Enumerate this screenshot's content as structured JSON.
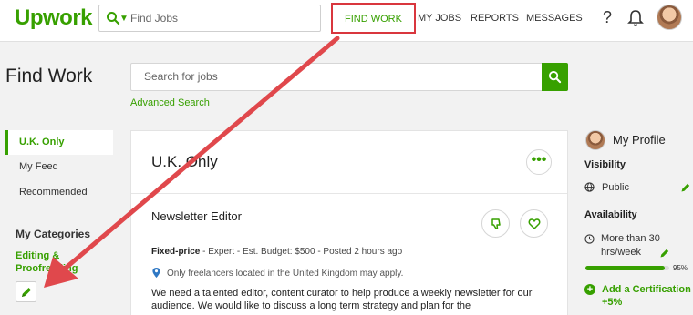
{
  "header": {
    "logo": "Upwork",
    "search_placeholder": "Find Jobs",
    "nav": {
      "find_work": "FIND WORK",
      "my_jobs": "MY JOBS",
      "reports": "REPORTS",
      "messages": "MESSAGES"
    },
    "help": "?"
  },
  "page": {
    "title": "Find Work",
    "search_placeholder": "Search for jobs",
    "advanced_search": "Advanced Search"
  },
  "sidebar": {
    "items": [
      {
        "label": "U.K. Only",
        "active": true
      },
      {
        "label": "My Feed"
      },
      {
        "label": "Recommended"
      }
    ],
    "categories_heading": "My Categories",
    "category": "Editing & Proofreading"
  },
  "feed": {
    "title": "U.K. Only",
    "more": "•••",
    "job": {
      "title": "Newsletter Editor",
      "budget_type": "Fixed-price",
      "details": " - Expert - Est. Budget: $500 - Posted 2 hours ago",
      "location_note": "Only freelancers located in the United Kingdom may apply.",
      "description": "We need a talented editor, content curator to help produce a weekly newsletter for our audience. We would like to discuss a long term strategy and plan for the"
    }
  },
  "profile": {
    "title": "My Profile",
    "visibility_heading": "Visibility",
    "visibility_value": "Public",
    "availability_heading": "Availability",
    "availability_value": "More than 30 hrs/week",
    "completeness": 0.95,
    "completeness_label": "95%",
    "add_cert": "Add a Certification +5%"
  },
  "colors": {
    "brand_green": "#37a000",
    "highlight_red": "#d9363e",
    "arrow_red": "#e0484c"
  }
}
